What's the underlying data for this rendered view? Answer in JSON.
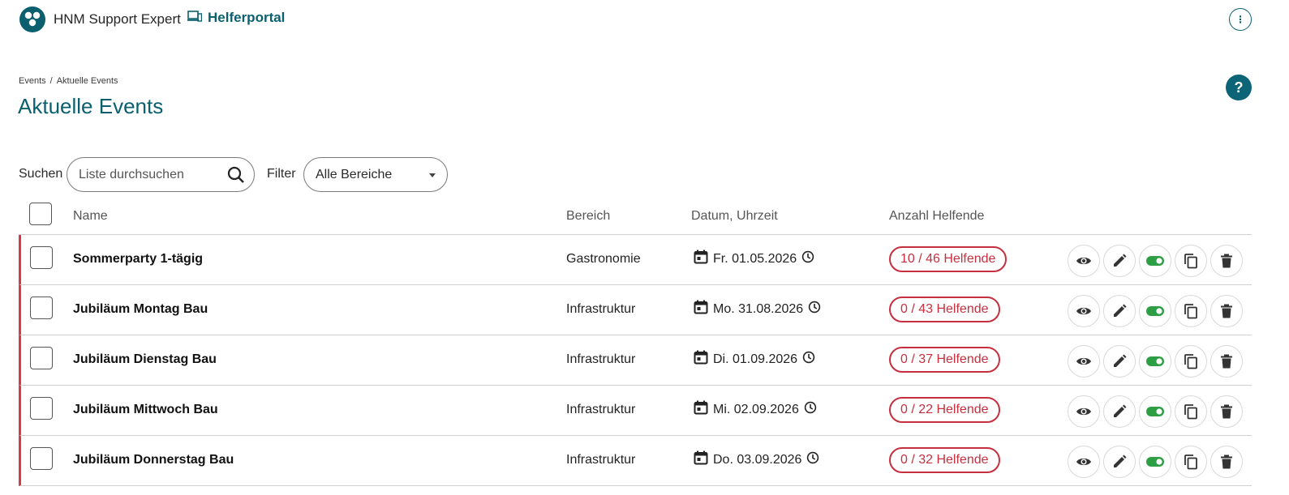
{
  "app": {
    "name": "HNM Support Expert",
    "portal_label": "Helferportal"
  },
  "breadcrumb": {
    "items": [
      "Events",
      "Aktuelle Events"
    ],
    "separator": "/"
  },
  "page_title": "Aktuelle Events",
  "toolbar": {
    "search_label": "Suchen",
    "search_placeholder": "Liste durchsuchen",
    "filter_label": "Filter",
    "filter_value": "Alle Bereiche"
  },
  "table": {
    "columns": [
      "Name",
      "Bereich",
      "Datum, Uhrzeit",
      "Anzahl Helfende"
    ],
    "rows": [
      {
        "name": "Sommerparty 1-tägig",
        "area": "Gastronomie",
        "date": "Fr. 01.05.2026",
        "helpers": "10 / 46 Helfende"
      },
      {
        "name": "Jubiläum Montag Bau",
        "area": "Infrastruktur",
        "date": "Mo. 31.08.2026",
        "helpers": "0 / 43 Helfende"
      },
      {
        "name": "Jubiläum Dienstag Bau",
        "area": "Infrastruktur",
        "date": "Di. 01.09.2026",
        "helpers": "0 / 37 Helfende"
      },
      {
        "name": "Jubiläum Mittwoch Bau",
        "area": "Infrastruktur",
        "date": "Mi. 02.09.2026",
        "helpers": "0 / 22 Helfende"
      },
      {
        "name": "Jubiläum Donnerstag Bau",
        "area": "Infrastruktur",
        "date": "Do. 03.09.2026",
        "helpers": "0 / 32 Helfende"
      }
    ]
  },
  "row_actions": [
    "eye-icon",
    "pencil-icon",
    "toggle-icon",
    "copy-icon",
    "trash-icon"
  ],
  "colors": {
    "primary": "#0b6070",
    "alert": "#c62f3e",
    "toggle_on": "#2e9e44"
  }
}
